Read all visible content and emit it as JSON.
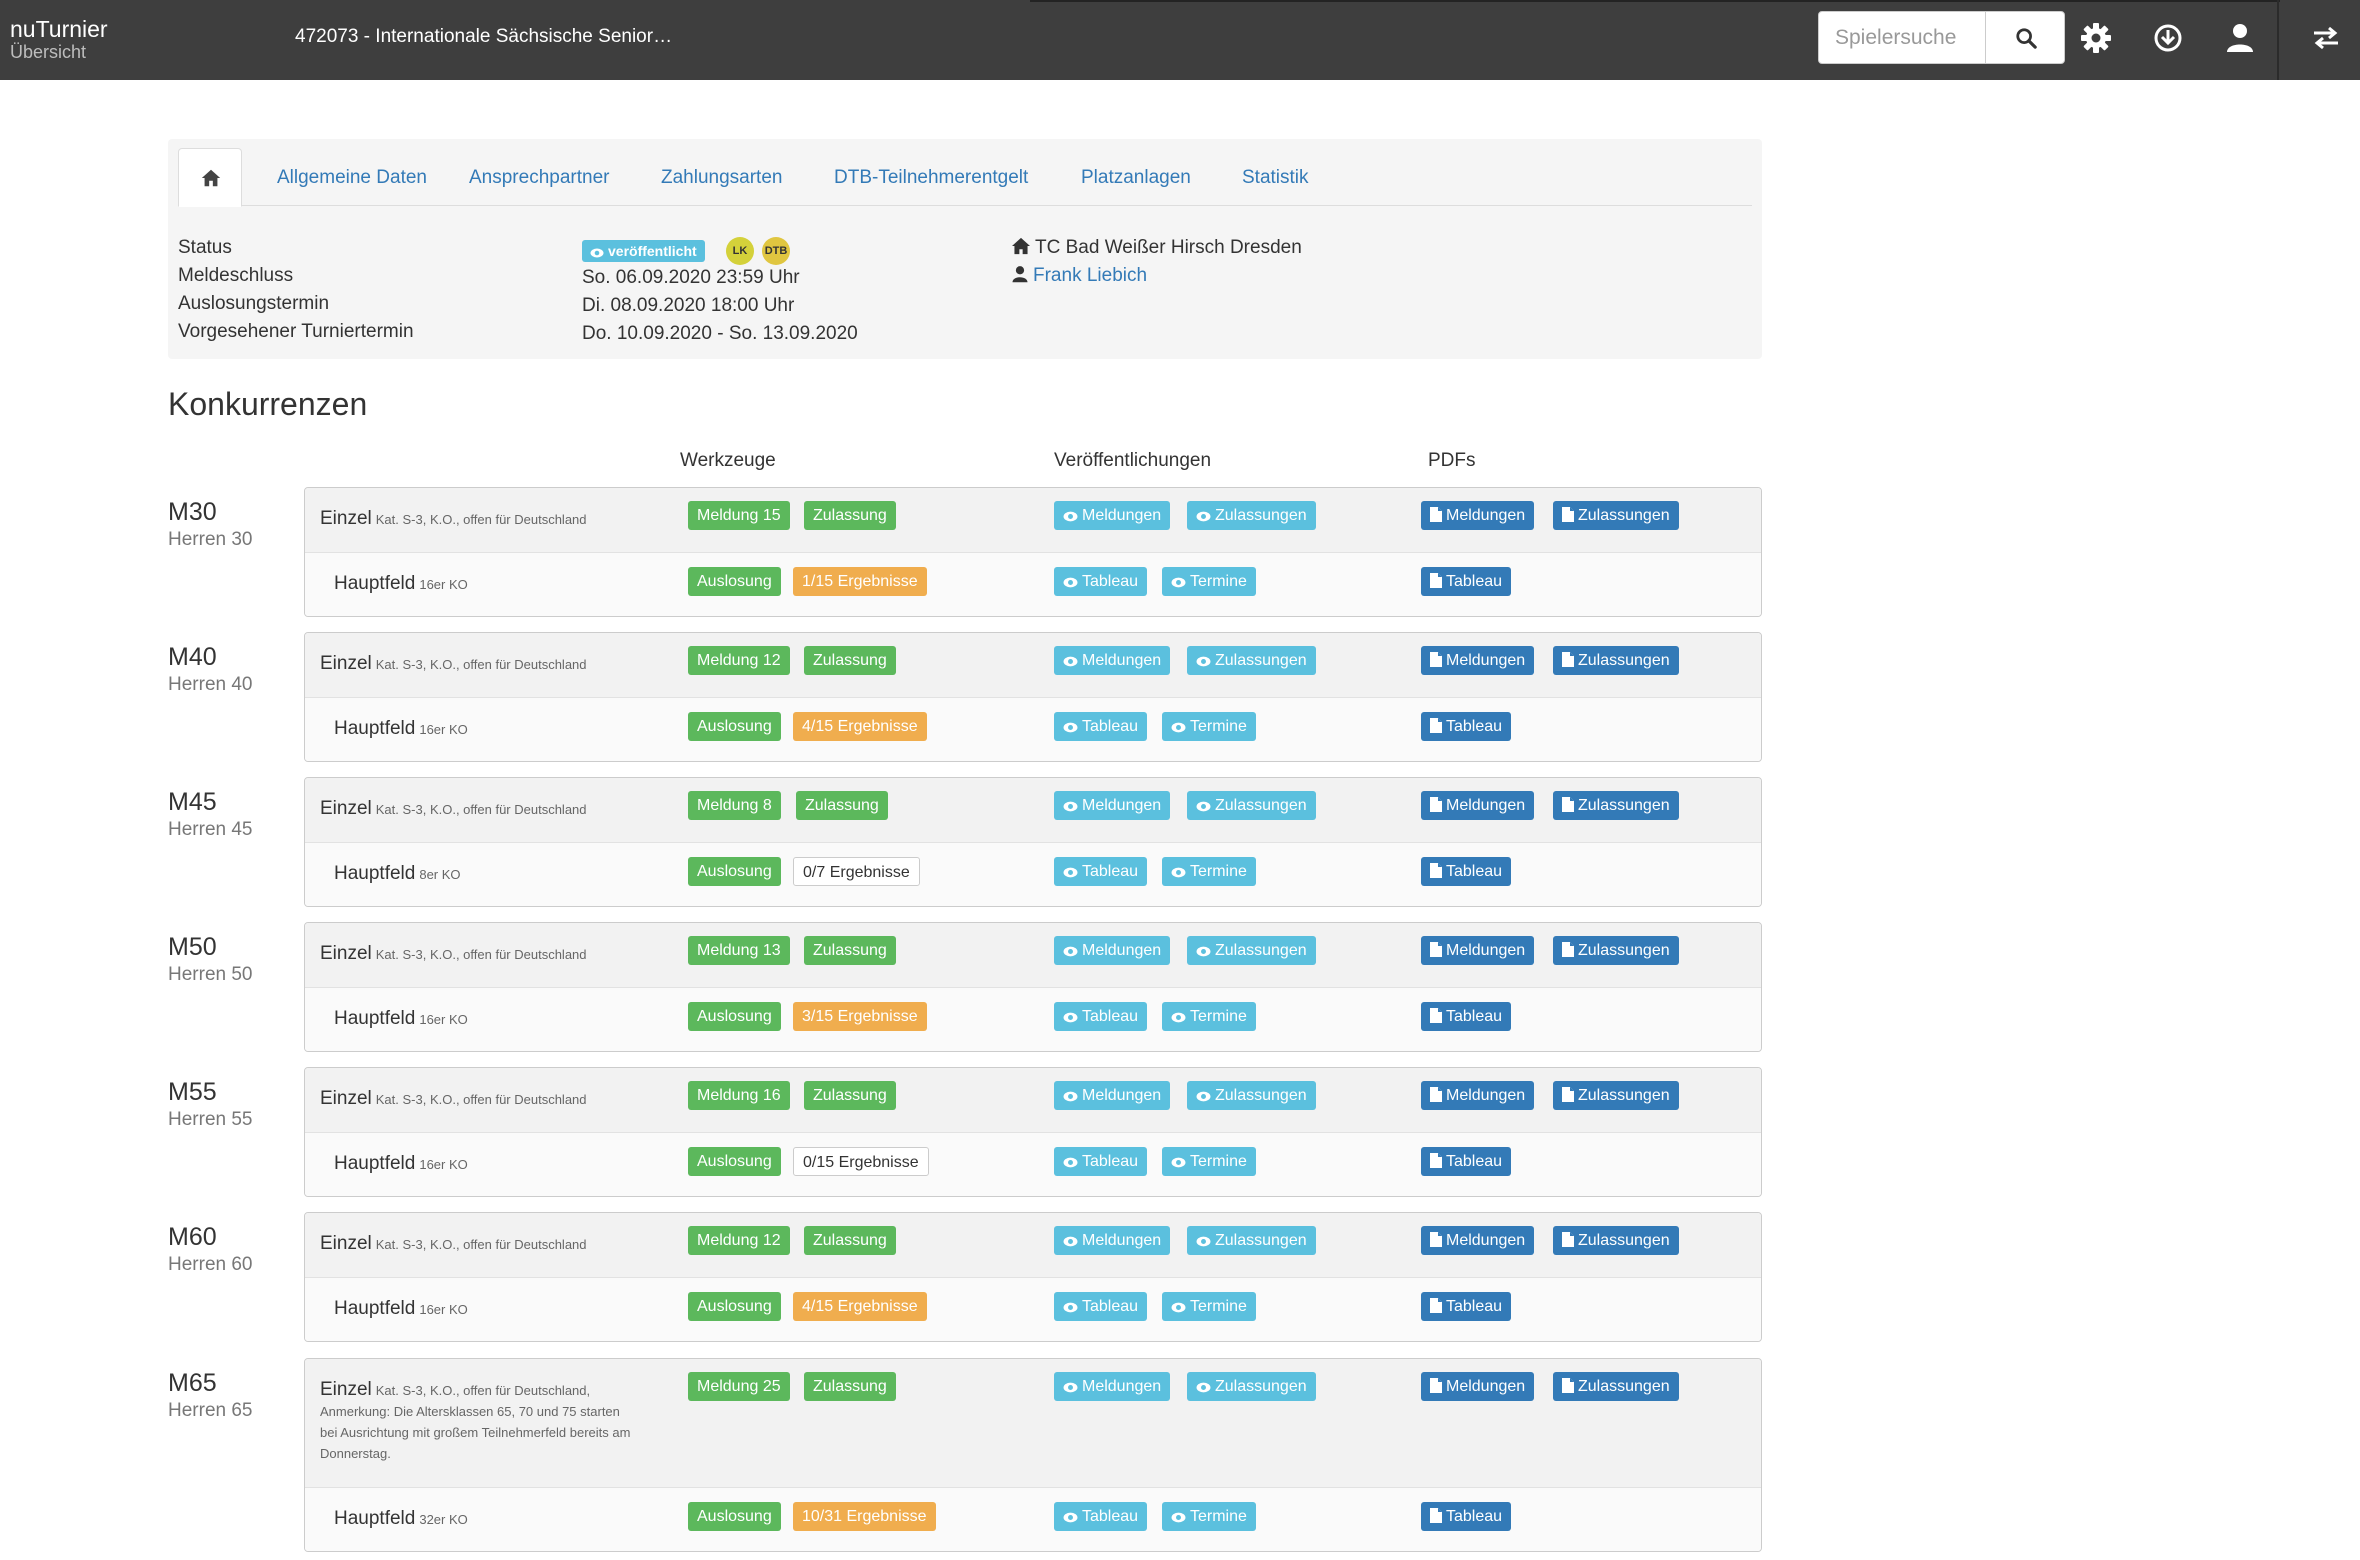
{
  "header": {
    "app_name": "nuTurnier",
    "app_sub": "Übersicht",
    "tournament": "472073 - Internationale Sächsische Senior…",
    "search_placeholder": "Spielersuche"
  },
  "tabs": [
    "Allgemeine Daten",
    "Ansprechpartner",
    "Zahlungsarten",
    "DTB-Teilnehmerentgelt",
    "Platzanlagen",
    "Statistik"
  ],
  "info": {
    "status_label": "Status",
    "status_badge": "veröffentlicht",
    "coin_lk": "LK",
    "coin_dtb": "DTB",
    "meldeschluss_label": "Meldeschluss",
    "meldeschluss": "So. 06.09.2020 23:59 Uhr",
    "auslosung_label": "Auslosungstermin",
    "auslosung": "Di. 08.09.2020 18:00 Uhr",
    "termin_label": "Vorgesehener Turniertermin",
    "termin": "Do. 10.09.2020 - So. 13.09.2020",
    "venue": "TC Bad Weißer Hirsch Dresden",
    "contact": "Frank Liebich"
  },
  "section_title": "Konkurrenzen",
  "columns": {
    "tools": "Werkzeuge",
    "publications": "Veröffentlichungen",
    "pdfs": "PDFs"
  },
  "common": {
    "einzel": "Einzel",
    "einzel_meta": "Kat. S-3, K.O., offen für Deutschland",
    "hauptfeld": "Hauptfeld",
    "zulassung": "Zulassung",
    "auslosung": "Auslosung",
    "meldungen": "Meldungen",
    "zulassungen": "Zulassungen",
    "tableau": "Tableau",
    "termine": "Termine"
  },
  "groups": [
    {
      "code": "M30",
      "sub": "Herren 30",
      "meldung": "Meldung 15",
      "draw": "16er KO",
      "results": "1/15 Ergebnisse",
      "results_style": "orange"
    },
    {
      "code": "M40",
      "sub": "Herren 40",
      "meldung": "Meldung 12",
      "draw": "16er KO",
      "results": "4/15 Ergebnisse",
      "results_style": "orange"
    },
    {
      "code": "M45",
      "sub": "Herren 45",
      "meldung": "Meldung 8",
      "zulassung": "Zulassung",
      "draw": "8er KO",
      "results": "0/7 Ergebnisse",
      "results_style": "plain"
    },
    {
      "code": "M50",
      "sub": "Herren 50",
      "meldung": "Meldung 13",
      "draw": "16er KO",
      "results": "3/15 Ergebnisse",
      "results_style": "orange"
    },
    {
      "code": "M55",
      "sub": "Herren 55",
      "meldung": "Meldung 16",
      "draw": "16er KO",
      "results": "0/15 Ergebnisse",
      "results_style": "plain"
    },
    {
      "code": "M60",
      "sub": "Herren 60",
      "meldung": "Meldung 12",
      "draw": "16er KO",
      "results": "4/15 Ergebnisse",
      "results_style": "orange"
    },
    {
      "code": "M65",
      "sub": "Herren 65",
      "meldung": "Meldung 25",
      "draw": "32er KO",
      "results": "10/31 Ergebnisse",
      "results_style": "orange",
      "einzel_meta": "Kat. S-3, K.O., offen für Deutschland,",
      "note": "Anmerkung: Die Altersklassen 65, 70 und 75 starten bei Ausrichtung mit großem Teilnehmerfeld bereits am Donnerstag."
    }
  ],
  "colors": {
    "topbar": "#3e3e3e",
    "success": "#5cb85c",
    "warning": "#f0ad4e",
    "info": "#5bc0de",
    "primary": "#337ab7"
  }
}
